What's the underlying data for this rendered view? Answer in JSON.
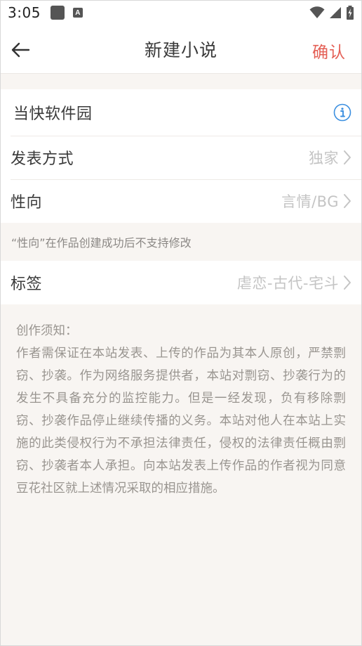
{
  "status_bar": {
    "time": "3:05"
  },
  "nav": {
    "title": "新建小说",
    "confirm_label": "确认",
    "accent_color": "#e45f55"
  },
  "rows": {
    "software": {
      "label": "当快软件园"
    },
    "publish": {
      "label": "发表方式",
      "value": "独家"
    },
    "orientation": {
      "label": "性向",
      "value": "言情/BG"
    },
    "tags": {
      "label": "标签",
      "value": "虐恋-古代-宅斗"
    }
  },
  "orientation_note": "“性向”在作品创建成功后不支持修改",
  "notice": {
    "title": "创作须知：",
    "body": "作者需保证在本站发表、上传的作品为其本人原创，严禁剽窃、抄袭。作为网络服务提供者，本站对剽窃、抄袭行为的发生不具备充分的监控能力。但是一经发现，负有移除剽窃、抄袭作品停止继续传播的义务。本站对他人在本站上实施的此类侵权行为不承担法律责任，侵权的法律责任概由剽窃、抄袭者本人承担。向本站发表上传作品的作者视为同意豆花社区就上述情况采取的相应措施。"
  },
  "icons": {
    "info": "info-icon",
    "chevron": "chevron-right-icon",
    "back": "arrow-left-icon"
  }
}
